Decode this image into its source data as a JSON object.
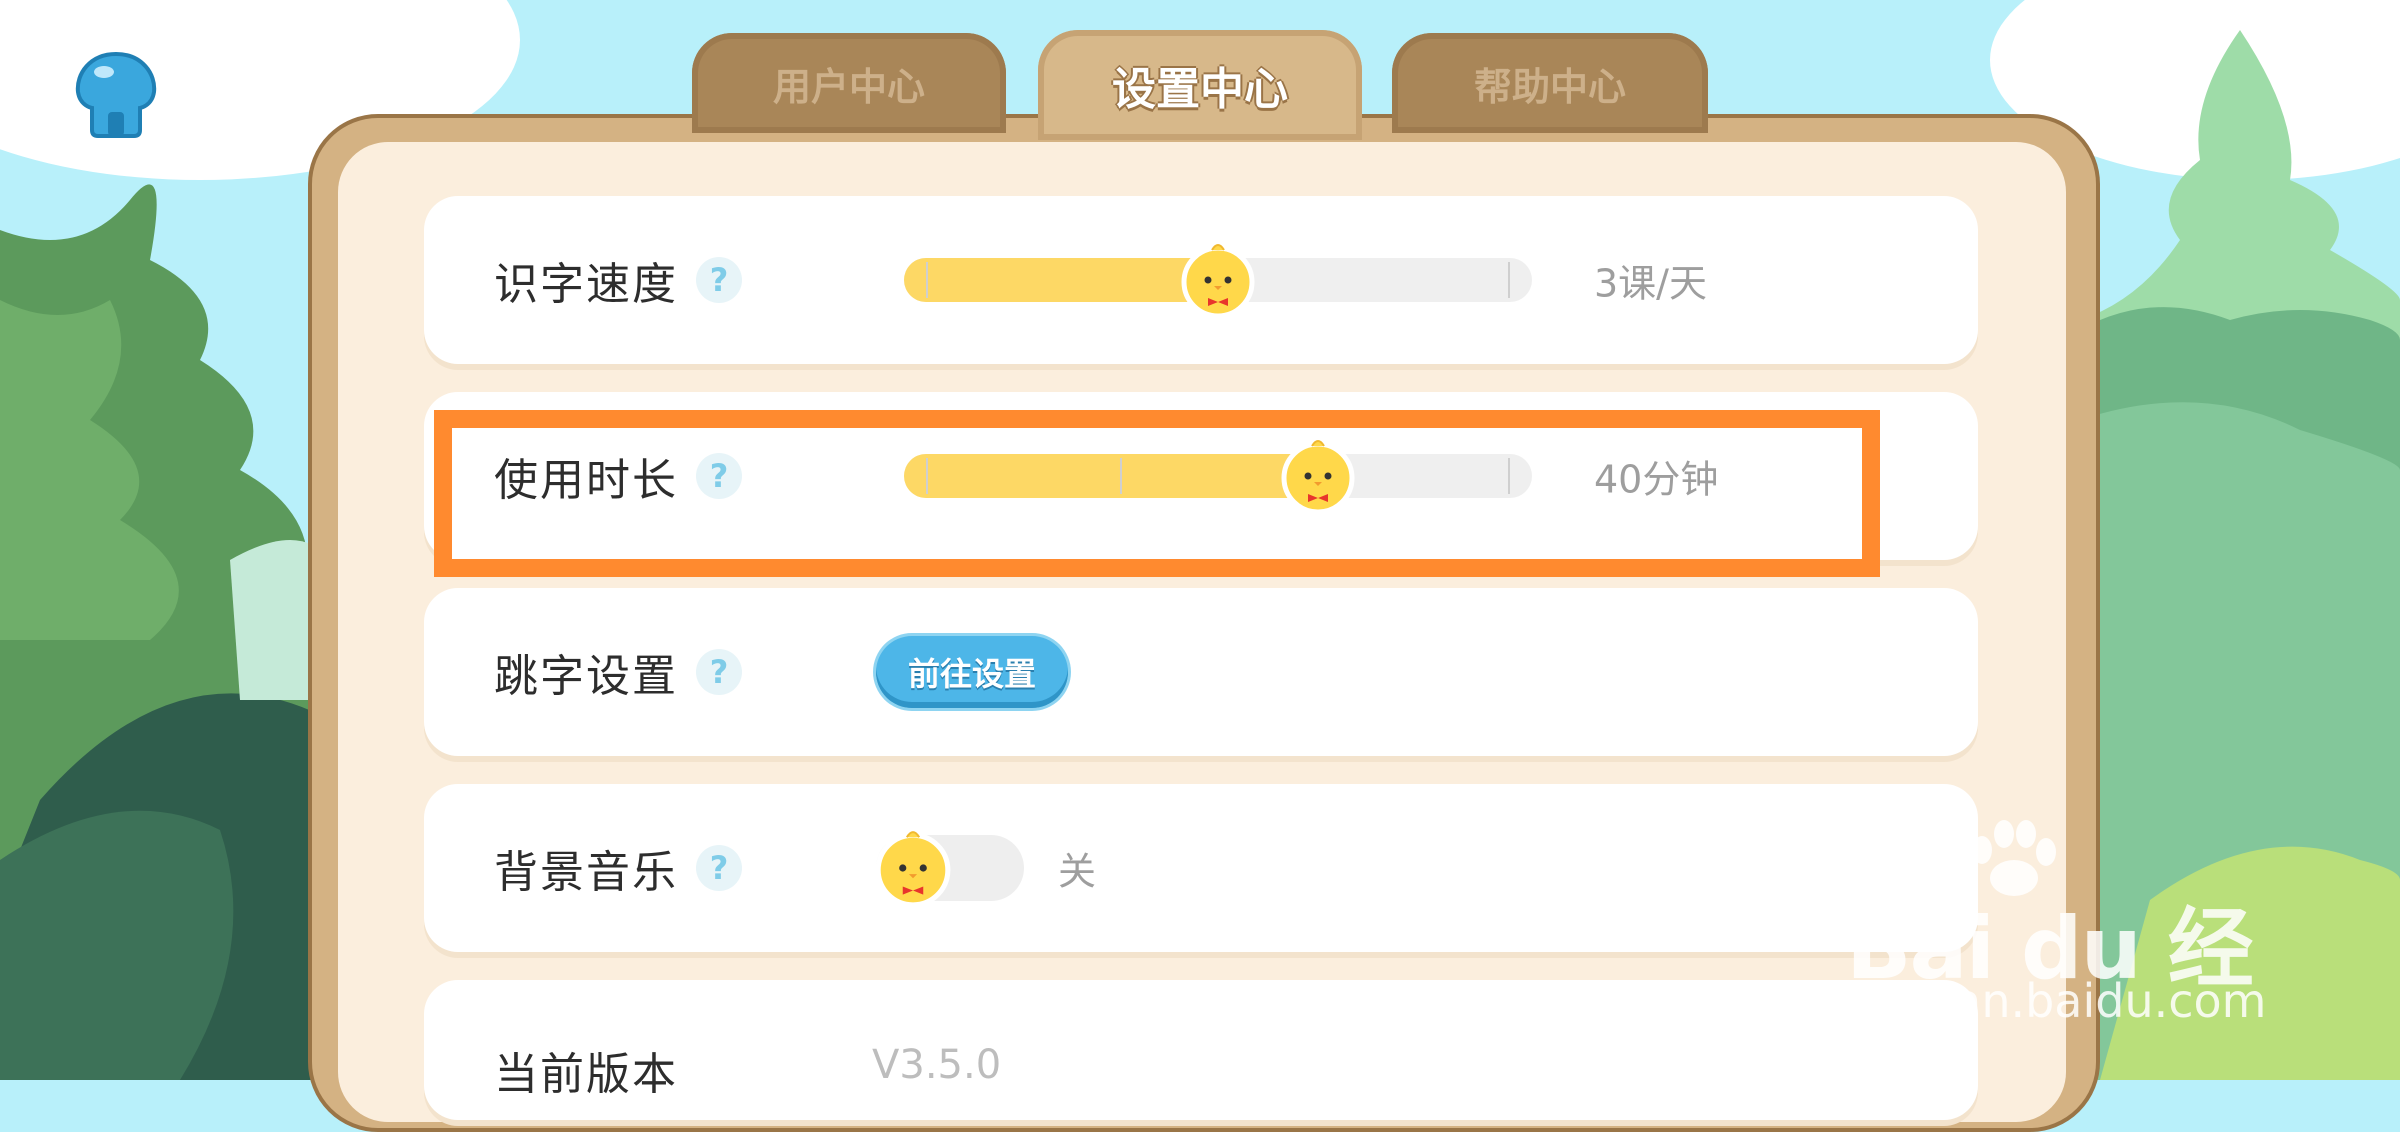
{
  "tabs": [
    {
      "label": "用户中心",
      "active": false
    },
    {
      "label": "设置中心",
      "active": true
    },
    {
      "label": "帮助中心",
      "active": false
    }
  ],
  "settings": {
    "speed": {
      "label": "识字速度",
      "help": "?",
      "value_text": "3课/天",
      "level": 0.5
    },
    "duration": {
      "label": "使用时长",
      "help": "?",
      "value_text": "40分钟",
      "level": 0.66
    },
    "skip": {
      "label": "跳字设置",
      "help": "?",
      "button_label": "前往设置"
    },
    "music": {
      "label": "背景音乐",
      "help": "?",
      "state_text": "关",
      "on": false
    },
    "version": {
      "label": "当前版本",
      "value": "V3.5.0"
    }
  },
  "watermark": {
    "main": "Bai du 经验",
    "sub": "jingyan.baidu.com"
  },
  "colors": {
    "accent_orange": "#ff8a2f",
    "slider_fill": "#fdd865",
    "button_blue": "#4db6e8",
    "panel_brown": "#d4b283"
  },
  "icons": {
    "home": "home-icon",
    "chick": "chick-mascot-icon",
    "help": "question-icon"
  }
}
